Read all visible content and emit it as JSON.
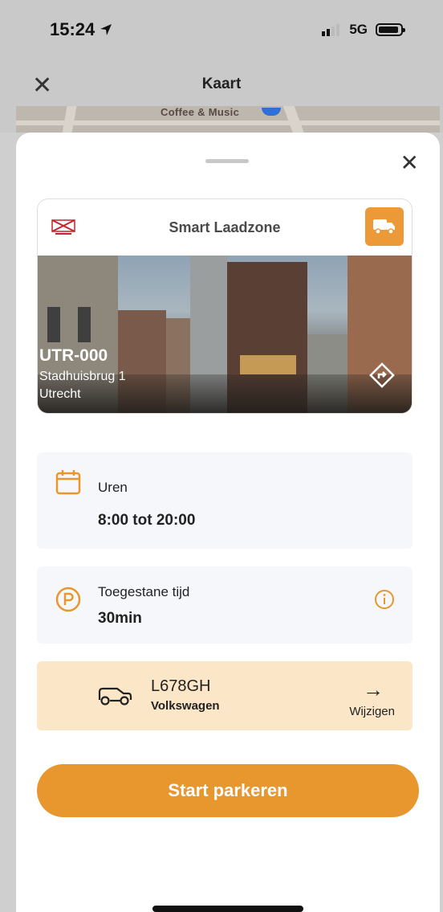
{
  "status_bar": {
    "time": "15:24",
    "network": "5G"
  },
  "header": {
    "title": "Kaart",
    "map_label": "Coffee & Music"
  },
  "zone": {
    "title": "Smart Laadzone",
    "code": "UTR-000",
    "street": "Stadhuisbrug 1",
    "city": "Utrecht"
  },
  "hours": {
    "label": "Uren",
    "value": "8:00 tot 20:00"
  },
  "allowed_time": {
    "label": "Toegestane tijd",
    "value": "30min"
  },
  "vehicle": {
    "plate": "L678GH",
    "brand": "Volkswagen",
    "change_label": "Wijzigen"
  },
  "actions": {
    "start_label": "Start parkeren"
  },
  "colors": {
    "accent": "#e8972f",
    "vehicle_bg": "#fbe7c8",
    "info_bg": "#f5f7fa"
  }
}
